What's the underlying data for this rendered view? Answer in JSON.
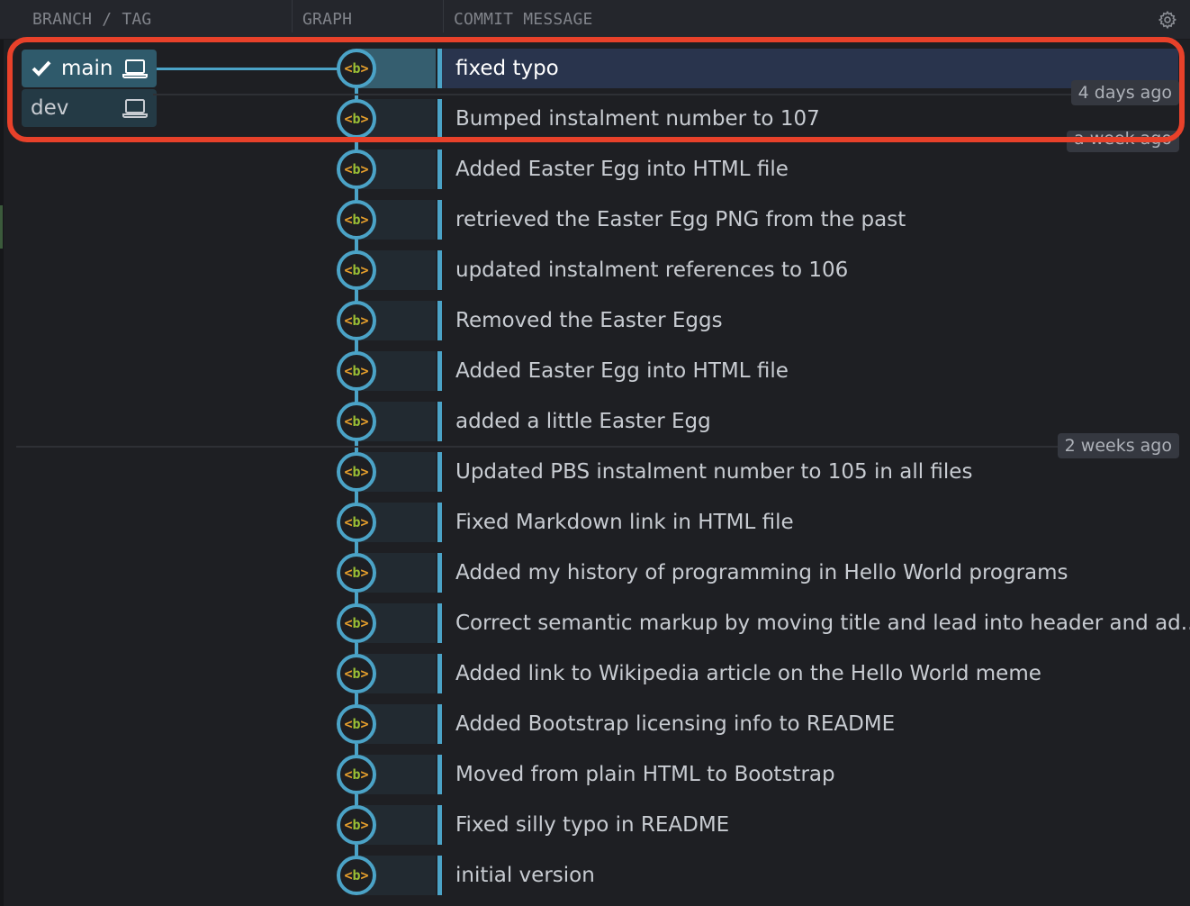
{
  "header": {
    "columns": [
      "BRANCH / TAG",
      "GRAPH",
      "COMMIT MESSAGE"
    ],
    "settings_icon": "gear-icon"
  },
  "branches": [
    {
      "name": "main",
      "current": true,
      "icons": [
        "check-icon",
        "laptop-icon"
      ]
    },
    {
      "name": "dev",
      "current": false,
      "icons": [
        "laptop-icon"
      ]
    }
  ],
  "commits": [
    {
      "message": "fixed typo",
      "avatar": "<b>",
      "selected": true
    },
    {
      "message": "Bumped instalment number to 107",
      "avatar": "<b>"
    },
    {
      "message": "Added Easter Egg into HTML file",
      "avatar": "<b>"
    },
    {
      "message": "retrieved the Easter Egg PNG from the past",
      "avatar": "<b>"
    },
    {
      "message": "updated instalment references to 106",
      "avatar": "<b>"
    },
    {
      "message": "Removed the Easter Eggs",
      "avatar": "<b>"
    },
    {
      "message": "Added Easter Egg into HTML file",
      "avatar": "<b>"
    },
    {
      "message": "added a little Easter Egg",
      "avatar": "<b>"
    },
    {
      "message": "Updated PBS instalment number to 105 in all files",
      "avatar": "<b>"
    },
    {
      "message": "Fixed Markdown link in HTML file",
      "avatar": "<b>"
    },
    {
      "message": "Added my history of programming in Hello World programs",
      "avatar": "<b>"
    },
    {
      "message": "Correct semantic markup by moving title and lead into header and ad...",
      "avatar": "<b>"
    },
    {
      "message": "Added link to Wikipedia article on the Hello World meme",
      "avatar": "<b>"
    },
    {
      "message": "Added Bootstrap licensing info to README",
      "avatar": "<b>"
    },
    {
      "message": "Moved from plain HTML to Bootstrap",
      "avatar": "<b>"
    },
    {
      "message": "Fixed silly typo in README",
      "avatar": "<b>"
    },
    {
      "message": "initial version",
      "avatar": "<b>"
    }
  ],
  "time_markers": [
    {
      "label": "4 days ago"
    },
    {
      "label": "a week ago"
    },
    {
      "label": "2 weeks ago"
    }
  ],
  "colors": {
    "graph_line": "#4ba3c7",
    "highlight": "#e8412a",
    "selected_row": "#29344d",
    "avatar_brackets": "#e8a02c",
    "avatar_letter": "#9ac035"
  }
}
